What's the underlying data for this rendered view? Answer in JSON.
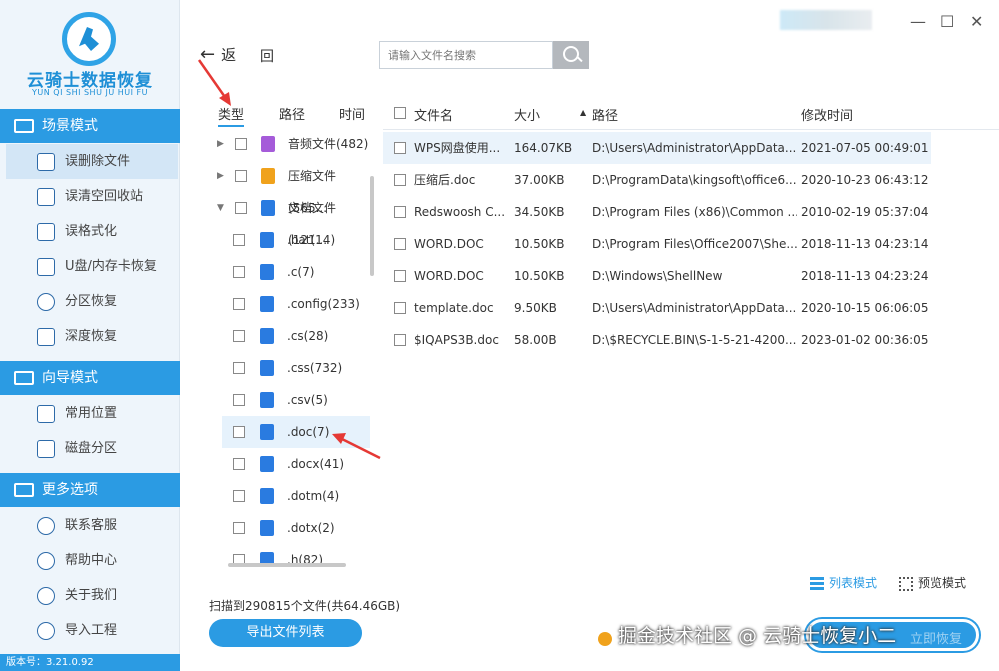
{
  "app": {
    "logo_title": "云骑士数据恢复",
    "logo_sub": "YUN QI SHI SHU JU HUI FU",
    "version": "版本号：3.21.0.92"
  },
  "sidebar": {
    "sections": [
      {
        "label": "场景模式",
        "icon": "monitor-icon"
      },
      {
        "label": "向导模式",
        "icon": "signpost-icon"
      },
      {
        "label": "更多选项",
        "icon": "menu-icon"
      }
    ],
    "scene_items": [
      {
        "label": "误删除文件",
        "icon": "delete-file-icon",
        "active": true
      },
      {
        "label": "误清空回收站",
        "icon": "recycle-bin-icon"
      },
      {
        "label": "误格式化",
        "icon": "format-icon"
      },
      {
        "label": "U盘/内存卡恢复",
        "icon": "usb-icon"
      },
      {
        "label": "分区恢复",
        "icon": "partition-icon"
      },
      {
        "label": "深度恢复",
        "icon": "deep-recover-icon"
      }
    ],
    "guide_items": [
      {
        "label": "常用位置",
        "icon": "windows-icon"
      },
      {
        "label": "磁盘分区",
        "icon": "disk-icon"
      }
    ],
    "more_items": [
      {
        "label": "联系客服",
        "icon": "phone-icon"
      },
      {
        "label": "帮助中心",
        "icon": "help-icon"
      },
      {
        "label": "关于我们",
        "icon": "info-icon"
      },
      {
        "label": "导入工程",
        "icon": "import-icon"
      }
    ]
  },
  "toolbar": {
    "back_label": "返",
    "return_label": "回",
    "search_placeholder": "请输入文件名搜索"
  },
  "tree": {
    "tabs": [
      "类型",
      "路径",
      "时间"
    ],
    "items": [
      {
        "label": "音频文件(482)",
        "icon": "music"
      },
      {
        "label": "压缩文件(565...",
        "icon": "zip"
      },
      {
        "label": "文档文件(121...",
        "icon": "doc"
      },
      {
        "label": ".bat(14)",
        "icon": "doc"
      },
      {
        "label": ".c(7)",
        "icon": "doc"
      },
      {
        "label": ".config(233)",
        "icon": "doc"
      },
      {
        "label": ".cs(28)",
        "icon": "doc"
      },
      {
        "label": ".css(732)",
        "icon": "doc"
      },
      {
        "label": ".csv(5)",
        "icon": "doc"
      },
      {
        "label": ".doc(7)",
        "icon": "doc"
      },
      {
        "label": ".docx(41)",
        "icon": "doc"
      },
      {
        "label": ".dotm(4)",
        "icon": "doc"
      },
      {
        "label": ".dotx(2)",
        "icon": "doc"
      },
      {
        "label": ".h(82)",
        "icon": "doc"
      }
    ]
  },
  "table": {
    "headers": [
      "文件名",
      "大小",
      "路径",
      "修改时间"
    ],
    "rows": [
      [
        "WPS网盘使用...",
        "164.07KB",
        "D:\\Users\\Administrator\\AppData...",
        "2021-07-05 00:49:01"
      ],
      [
        "压缩后.doc",
        "37.00KB",
        "D:\\ProgramData\\kingsoft\\office6...",
        "2020-10-23 06:43:12"
      ],
      [
        "Redswoosh C...",
        "34.50KB",
        "D:\\Program Files (x86)\\Common ...",
        "2010-02-19 05:37:04"
      ],
      [
        "WORD.DOC",
        "10.50KB",
        "D:\\Program Files\\Office2007\\She...",
        "2018-11-13 04:23:14"
      ],
      [
        "WORD.DOC",
        "10.50KB",
        "D:\\Windows\\ShellNew",
        "2018-11-13 04:23:24"
      ],
      [
        "template.doc",
        "9.50KB",
        "D:\\Users\\Administrator\\AppData...",
        "2020-10-15 06:06:05"
      ],
      [
        "$IQAPS3B.doc",
        "58.00B",
        "D:\\$RECYCLE.BIN\\S-1-5-21-4200...",
        "2023-01-02 00:36:05"
      ]
    ]
  },
  "footer": {
    "scan_text": "扫描到290815个文件(共64.46GB)",
    "export_label": "导出文件列表",
    "list_mode": "列表模式",
    "preview_mode": "预览模式",
    "watermark": "掘金技术社区 @ 云骑士恢复小二",
    "recover_label": "立即恢复"
  },
  "colors": {
    "accent": "#2b9be3",
    "sidebar_bg": "#eef5fb",
    "arrow": "#e53935"
  }
}
